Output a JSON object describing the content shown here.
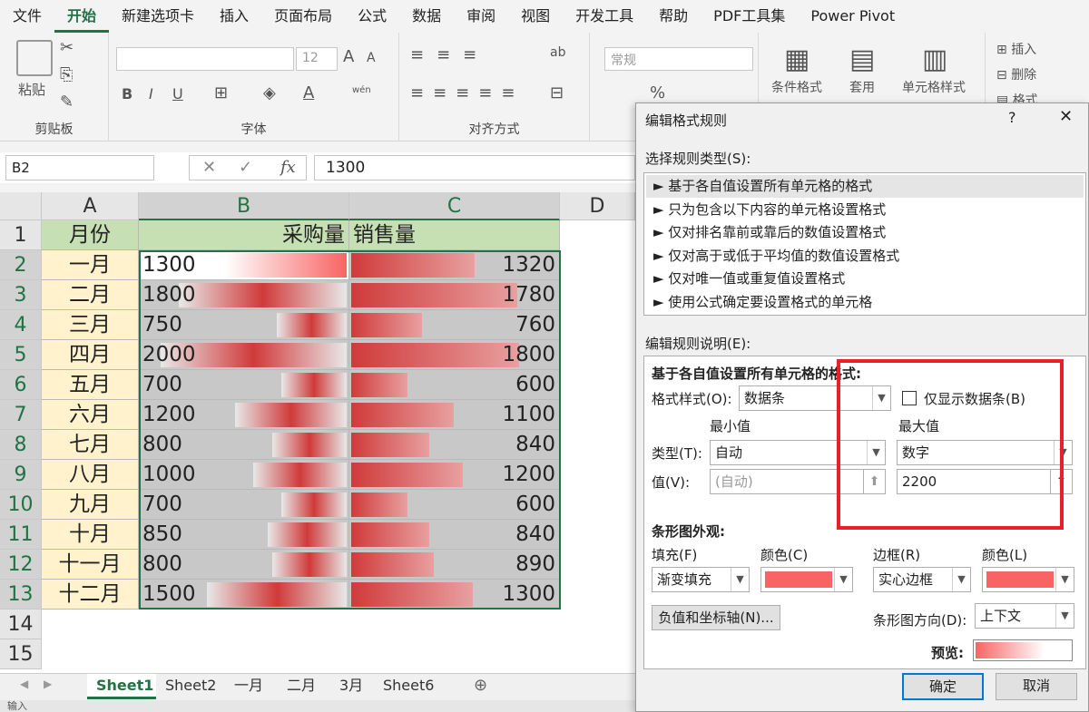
{
  "menu": {
    "items": [
      "文件",
      "开始",
      "新建选项卡",
      "插入",
      "页面布局",
      "公式",
      "数据",
      "审阅",
      "视图",
      "开发工具",
      "帮助",
      "PDF工具集",
      "Power Pivot"
    ],
    "active": 1
  },
  "ribbon": {
    "clipboard": {
      "label": "剪贴板",
      "paste": "粘贴"
    },
    "font": {
      "label": "字体",
      "size": "12",
      "bold": "B",
      "italic": "I",
      "underline": "U",
      "wen": "wén"
    },
    "align": {
      "label": "对齐方式"
    },
    "number": {
      "format": "常规",
      "percent": "%"
    },
    "styles": {
      "conditional": "条件格式",
      "table": "套用",
      "cell": "单元格样式"
    },
    "cells": {
      "insert": "插入",
      "delete": "删除",
      "format": "格式"
    }
  },
  "formula": {
    "namebox": "B2",
    "fx": "fx",
    "value": "1300"
  },
  "columns": [
    "A",
    "B",
    "C",
    "D"
  ],
  "rows": [
    "1",
    "2",
    "3",
    "4",
    "5",
    "6",
    "7",
    "8",
    "9",
    "10",
    "11",
    "12",
    "13",
    "14",
    "15"
  ],
  "table": {
    "headers": [
      "月份",
      "采购量",
      "销售量"
    ],
    "data": [
      {
        "month": "一月",
        "purchase": 1300,
        "sales": 1320
      },
      {
        "month": "二月",
        "purchase": 1800,
        "sales": 1780
      },
      {
        "month": "三月",
        "purchase": 750,
        "sales": 760
      },
      {
        "month": "四月",
        "purchase": 2000,
        "sales": 1800
      },
      {
        "month": "五月",
        "purchase": 700,
        "sales": 600
      },
      {
        "month": "六月",
        "purchase": 1200,
        "sales": 1100
      },
      {
        "month": "七月",
        "purchase": 800,
        "sales": 840
      },
      {
        "month": "八月",
        "purchase": 1000,
        "sales": 1200
      },
      {
        "month": "九月",
        "purchase": 700,
        "sales": 600
      },
      {
        "month": "十月",
        "purchase": 850,
        "sales": 840
      },
      {
        "month": "十一月",
        "purchase": 800,
        "sales": 890
      },
      {
        "month": "十二月",
        "purchase": 1500,
        "sales": 1300
      }
    ]
  },
  "sheets": [
    "Sheet1",
    "Sheet2",
    "一月",
    "二月",
    "3月",
    "Sheet6"
  ],
  "status": {
    "left": "输入"
  },
  "dialog": {
    "title": "编辑格式规则",
    "help": "?",
    "close": "✕",
    "select_type_label": "选择规则类型(S):",
    "rule_types": [
      "► 基于各自值设置所有单元格的格式",
      "► 只为包含以下内容的单元格设置格式",
      "► 仅对排名靠前或靠后的数值设置格式",
      "► 仅对高于或低于平均值的数值设置格式",
      "► 仅对唯一值或重复值设置格式",
      "► 使用公式确定要设置格式的单元格"
    ],
    "edit_desc_label": "编辑规则说明(E):",
    "desc_title": "基于各自值设置所有单元格的格式:",
    "format_style_label": "格式样式(O):",
    "format_style_value": "数据条",
    "show_bar_only": "仅显示数据条(B)",
    "min_label": "最小值",
    "max_label": "最大值",
    "type_label": "类型(T):",
    "min_type": "自动",
    "max_type": "数字",
    "value_label": "值(V):",
    "min_value": "(自动)",
    "max_value": "2200",
    "bar_appearance": "条形图外观:",
    "fill_label": "填充(F)",
    "fill_color_label": "颜色(C)",
    "border_label": "边框(R)",
    "border_color_label": "颜色(L)",
    "fill_value": "渐变填充",
    "border_value": "实心边框",
    "negative_axis": "负值和坐标轴(N)...",
    "bar_direction_label": "条形图方向(D):",
    "bar_direction_value": "上下文",
    "preview_label": "预览:",
    "ok": "确定",
    "cancel": "取消",
    "bar_color": "#f86464"
  }
}
